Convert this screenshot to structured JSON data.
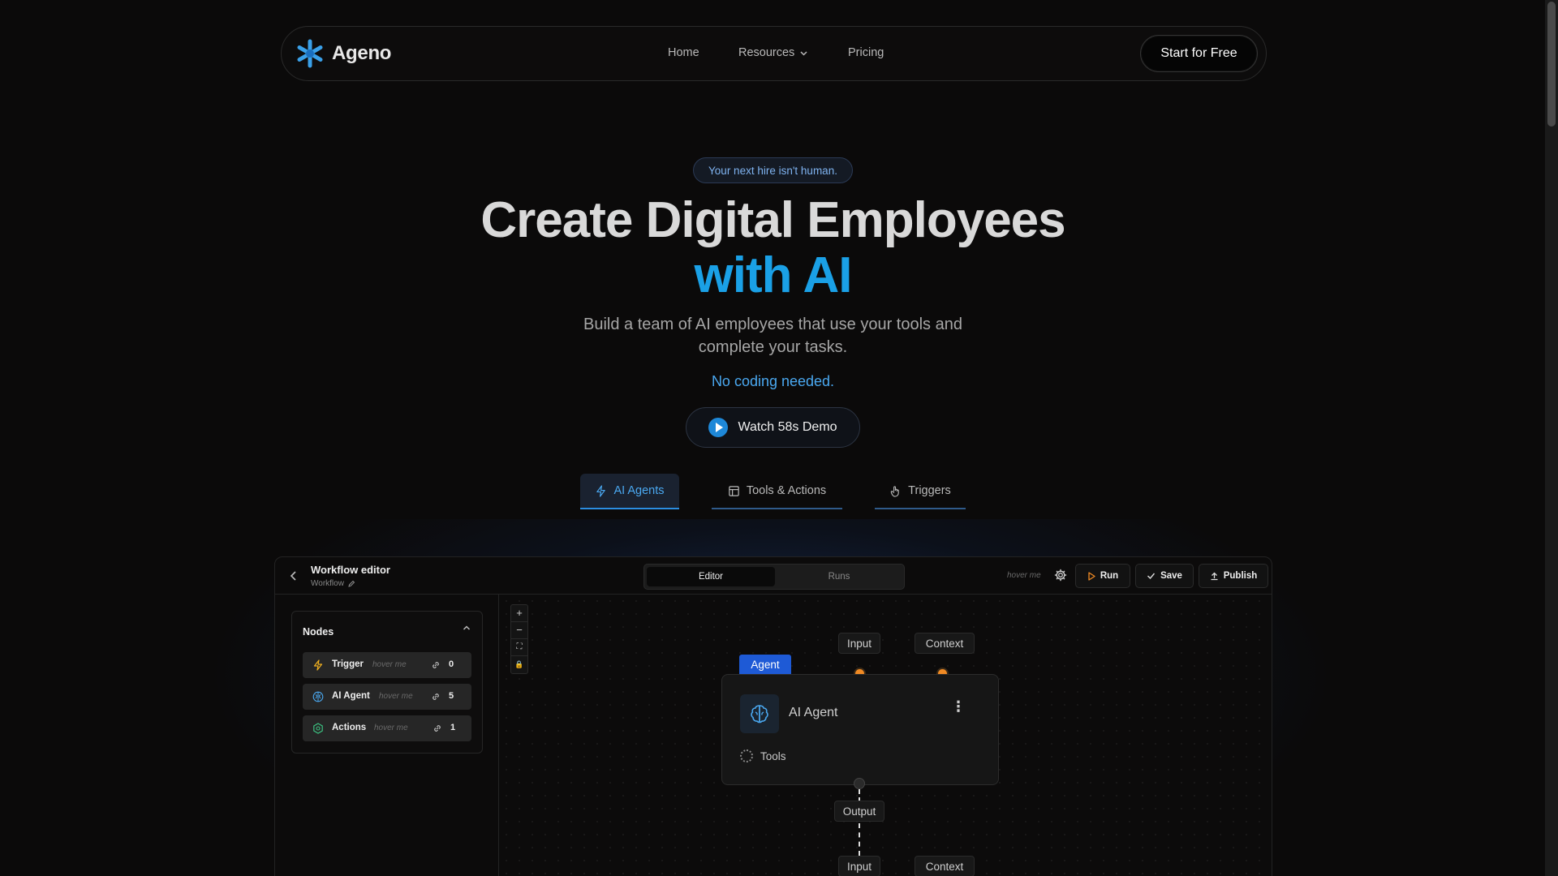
{
  "brand": {
    "name": "Ageno",
    "accent": "#1aa0e6"
  },
  "nav": {
    "home": "Home",
    "resources": "Resources",
    "pricing": "Pricing",
    "cta": "Start for Free"
  },
  "hero": {
    "badge": "Your next hire isn't human.",
    "title_line1": "Create Digital Employees",
    "title_line2": "with AI",
    "subtitle": "Build a team of AI employees that use your tools and complete your tasks.",
    "no_code": "No coding needed.",
    "demo_button": "Watch 58s Demo"
  },
  "tabs": [
    {
      "label": "AI Agents",
      "icon": "lightning-icon",
      "active": true
    },
    {
      "label": "Tools & Actions",
      "icon": "layout-icon",
      "active": false
    },
    {
      "label": "Triggers",
      "icon": "hand-pointer-icon",
      "active": false
    }
  ],
  "editor": {
    "title": "Workflow editor",
    "subtitle": "Workflow",
    "segments": {
      "editor": "Editor",
      "runs": "Runs",
      "selected": "Editor"
    },
    "hover_hint": "hover me",
    "buttons": {
      "run": "Run",
      "save": "Save",
      "publish": "Publish"
    },
    "nodes_panel": {
      "title": "Nodes",
      "items": [
        {
          "name": "Trigger",
          "hint": "hover me",
          "count": "0",
          "icon": "lightning-icon"
        },
        {
          "name": "AI Agent",
          "hint": "hover me",
          "count": "5",
          "icon": "brain-icon"
        },
        {
          "name": "Actions",
          "hint": "hover me",
          "count": "1",
          "icon": "hexagon-icon"
        }
      ]
    },
    "zoom_controls": [
      "+",
      "−",
      "⛶",
      "🔒"
    ],
    "canvas": {
      "agent_tag": "Agent",
      "agent_name": "AI Agent",
      "tools_label": "Tools",
      "ports": {
        "input": "Input",
        "context": "Context",
        "output": "Output"
      },
      "next_ports": {
        "input": "Input",
        "context": "Context"
      }
    }
  }
}
